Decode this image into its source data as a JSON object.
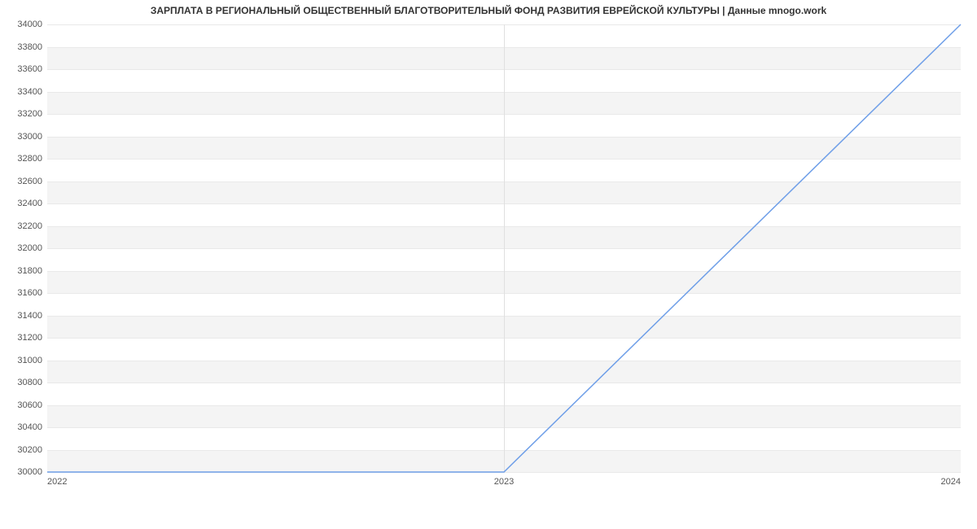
{
  "chart_data": {
    "type": "line",
    "title": "ЗАРПЛАТА В РЕГИОНАЛЬНЫЙ ОБЩЕСТВЕННЫЙ БЛАГОТВОРИТЕЛЬНЫЙ ФОНД РАЗВИТИЯ ЕВРЕЙСКОЙ КУЛЬТУРЫ | Данные mnogo.work",
    "xlabel": "",
    "ylabel": "",
    "x": [
      "2022",
      "2023",
      "2024"
    ],
    "y": [
      30000,
      30000,
      34000
    ],
    "x_ticks": [
      "2022",
      "2023",
      "2024"
    ],
    "y_ticks": [
      30000,
      30200,
      30400,
      30600,
      30800,
      31000,
      31200,
      31400,
      31600,
      31800,
      32000,
      32200,
      32400,
      32600,
      32800,
      33000,
      33200,
      33400,
      33600,
      33800,
      34000
    ],
    "ylim": [
      30000,
      34000
    ],
    "series_color": "#6f9fe8",
    "grid": true
  }
}
